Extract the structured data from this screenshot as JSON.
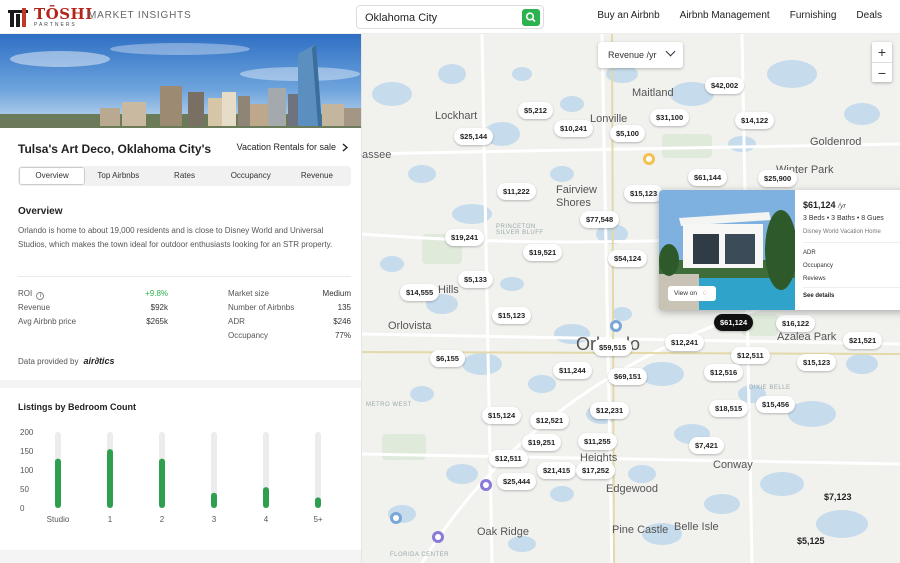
{
  "header": {
    "brand": "TŌSHI",
    "brand_sub": "PARTNERS",
    "section": "MARKET INSIGHTS",
    "search_value": "Oklahoma City",
    "nav": [
      "Buy an Airbnb",
      "Airbnb Management",
      "Furnishing",
      "Deals"
    ]
  },
  "left": {
    "city_title": "Tulsa's Art Deco, Oklahoma City's",
    "vacation_link": "Vacation Rentals for sale",
    "tabs": [
      "Overview",
      "Top Airbnbs",
      "Rates",
      "Occupancy",
      "Revenue"
    ],
    "active_tab": "Overview",
    "overview_title": "Overview",
    "overview_text": "Orlando is home to about 19,000 residents and is close to Disney World and Universal Studios, which makes the town ideal for outdoor enthusiasts looking for an STR property.",
    "stats_left": [
      {
        "label": "ROI",
        "value": "+9.8%"
      },
      {
        "label": "Revenue",
        "value": "$92k"
      },
      {
        "label": "Avg Airbnb price",
        "value": "$265k"
      }
    ],
    "stats_right": [
      {
        "label": "Market size",
        "value": "Medium"
      },
      {
        "label": "Number of Airbnbs",
        "value": "135"
      },
      {
        "label": "ADR",
        "value": "$246"
      },
      {
        "label": "Occupancy",
        "value": "77%"
      }
    ],
    "provided_by": "Data provided by",
    "provider": "air∂tics",
    "colors": {
      "accent_green": "#2eb24f",
      "brand_red": "#b3241b"
    }
  },
  "chart_data": {
    "type": "bar",
    "title": "Listings by Bedroom Count",
    "categories": [
      "Studio",
      "1",
      "2",
      "3",
      "4",
      "5+"
    ],
    "values": [
      130,
      155,
      130,
      40,
      55,
      28
    ],
    "yticks": [
      0,
      50,
      100,
      150,
      200
    ],
    "ylim": [
      0,
      200
    ],
    "xlabel": "",
    "ylabel": "",
    "bar_color": "#2e9e4f",
    "track_color": "#ececec"
  },
  "map": {
    "revenue_dropdown": "Revenue /yr",
    "zoom_in": "+",
    "zoom_out": "−",
    "labels": [
      "Maitland",
      "Lockhart",
      "Goldenrod",
      "Fairview Shores",
      "Orlovista",
      "Azalea Park",
      "Conway",
      "Edgewood",
      "Oak Ridge",
      "Pine Castle",
      "Belle Isle",
      "Orlando",
      "PRINCETON SILVER BLUFF",
      "METRO WEST",
      "DIXIE BELLE",
      "FLORIDA CENTER",
      "Winter Park",
      "Hills",
      "Heights",
      "assee",
      "Lonville"
    ],
    "prices": [
      "$5,212",
      "$42,002",
      "$25,144",
      "$10,241",
      "$5,100",
      "$31,100",
      "$14,122",
      "$61,144",
      "$25,900",
      "$11,222",
      "$15,123",
      "$77,548",
      "$19,241",
      "$19,521",
      "$54,124",
      "$5,133",
      "$14,555",
      "$15,123",
      "$61,124",
      "$16,122",
      "$6,155",
      "$59,515",
      "$12,241",
      "$12,511",
      "$21,521",
      "$15,123",
      "$11,244",
      "$69,151",
      "$12,516",
      "$15,124",
      "$12,521",
      "$12,231",
      "$18,515",
      "$15,456",
      "$19,251",
      "$11,255",
      "$7,421",
      "$12,511",
      "$21,415",
      "$17,252",
      "$25,444",
      "$7,123",
      "$5,125"
    ],
    "popup": {
      "price": "$61,124",
      "unit": "/yr",
      "meta": "3 Beds  •  3 Baths  •  8 Gues",
      "subtitle": "Disney World Vacation Home",
      "view_on": "View on",
      "rows": [
        "ADR",
        "Occupancy",
        "Reviews"
      ],
      "details": "See details"
    }
  }
}
